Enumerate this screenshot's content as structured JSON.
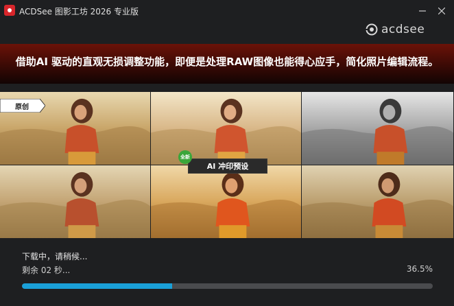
{
  "window": {
    "title": "ACDSee 图影工坊 2026 专业版",
    "brand_logo": "acdsee"
  },
  "banner": {
    "text": "借助AI 驱动的直观无损调整功能，即便是处理RAW图像也能得心应手，简化照片编辑流程。"
  },
  "preview": {
    "original_tag": "原创",
    "new_badge": "全新",
    "ai_preset_label": "AI 冲印预设"
  },
  "download": {
    "status": "下载中，请稍候...",
    "remaining": "剩余 02 秒...",
    "percent_text": "36.5%",
    "progress": 0.365
  },
  "colors": {
    "accent": "#1aa0d8",
    "banner_red": "#6b1208",
    "badge_green": "#3aa63a"
  }
}
